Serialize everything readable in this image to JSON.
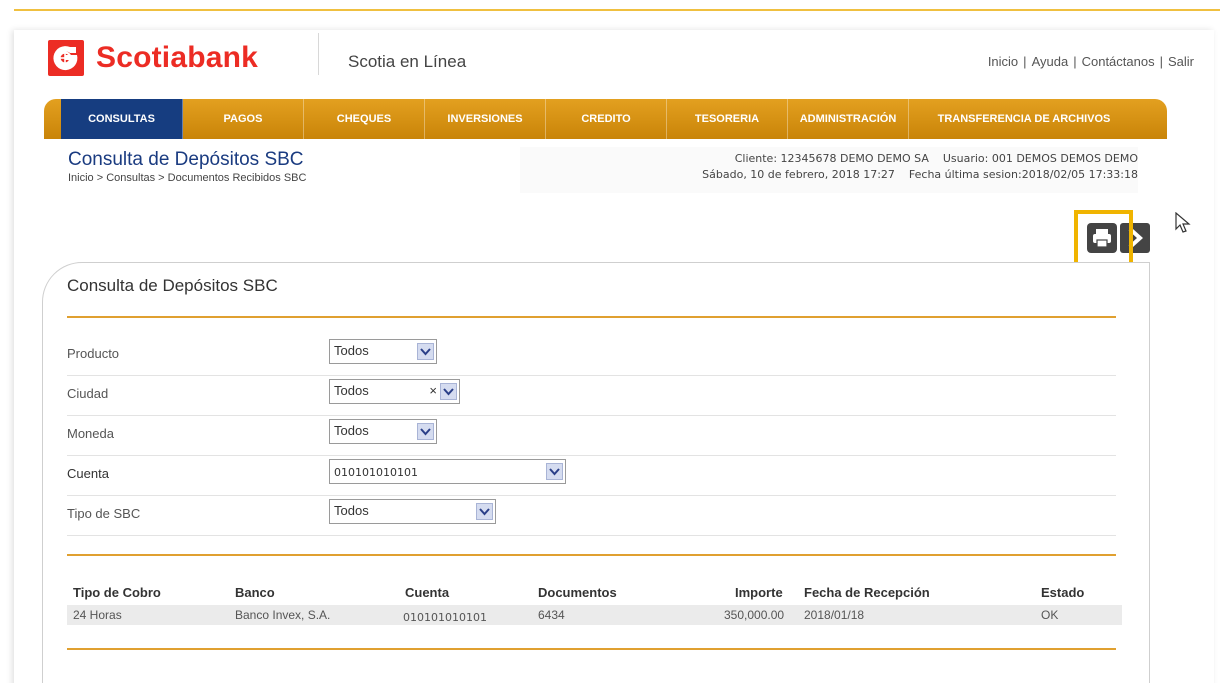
{
  "header": {
    "brand": "Scotiabank",
    "app_name": "Scotia en Línea",
    "links": [
      "Inicio",
      "Ayuda",
      "Contáctanos",
      "Salir"
    ],
    "link_separator": "|"
  },
  "nav": {
    "items": [
      {
        "label": "CONSULTAS",
        "active": true
      },
      {
        "label": "PAGOS",
        "active": false
      },
      {
        "label": "CHEQUES",
        "active": false
      },
      {
        "label": "INVERSIONES",
        "active": false
      },
      {
        "label": "CREDITO",
        "active": false
      },
      {
        "label": "TESORERIA",
        "active": false
      },
      {
        "label": "ADMINISTRACIÓN",
        "active": false
      },
      {
        "label": "TRANSFERENCIA DE ARCHIVOS",
        "active": false
      }
    ]
  },
  "page": {
    "title": "Consulta de Depósitos SBC",
    "breadcrumb_prefix": "Inicio > Consultas > ",
    "breadcrumb_current": "Documentos Recibidos SBC"
  },
  "client": {
    "line1": "Cliente: 12345678 DEMO DEMO SA    Usuario: 001 DEMOS DEMOS DEMO",
    "line2": "Sábado, 10 de febrero, 2018 17:27    Fecha última sesion:2018/02/05 17:33:18"
  },
  "panel": {
    "title": "Consulta de Depósitos SBC",
    "fields": [
      {
        "label": "Producto",
        "value": "Todos"
      },
      {
        "label": "Ciudad",
        "value": "Todos",
        "clear": "×"
      },
      {
        "label": "Moneda",
        "value": "Todos"
      },
      {
        "label": "Cuenta",
        "value": "010101010101"
      },
      {
        "label": "Tipo de SBC",
        "value": "Todos"
      }
    ]
  },
  "table": {
    "headers": [
      "Tipo de Cobro",
      "Banco",
      "Cuenta",
      "Documentos",
      "Importe",
      "Fecha de Recepción",
      "Estado"
    ],
    "rows": [
      [
        "24 Horas",
        "Banco Invex, S.A.",
        "010101010101",
        "6434",
        "350,000.00",
        "2018/01/18",
        "OK"
      ]
    ]
  },
  "colors": {
    "brand_red": "#ec2c24",
    "nav_orange": "#d7920f",
    "nav_active": "#163d80",
    "highlight": "#f0b400"
  },
  "icons": [
    "scotiabank-logo-icon",
    "print-icon",
    "next-arrow-icon",
    "mouse-cursor-icon"
  ]
}
